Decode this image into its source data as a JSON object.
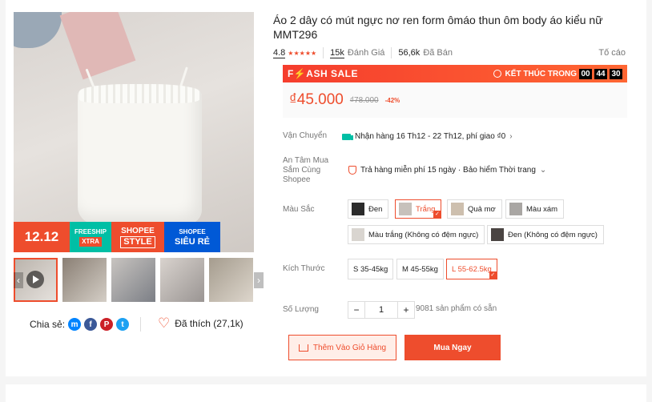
{
  "product": {
    "title": "Áo 2 dây có mút ngực nơ ren form ômáo thun ôm body áo kiểu nữ MMT296"
  },
  "gallery": {
    "promo": {
      "sale": "12.12",
      "freeship": "FREESHIP",
      "xtra": "XTRA",
      "shopee": "SHOPEE",
      "style": "STYLE",
      "shopee2": "SHOPEE",
      "sieure": "SIÊU RẺ"
    },
    "prev_arrow": "‹",
    "next_arrow": "›"
  },
  "share": {
    "label": "Chia sẻ:",
    "icons": [
      "messenger-icon",
      "facebook-icon",
      "pinterest-icon",
      "twitter-icon"
    ],
    "glyphs": [
      "m",
      "f",
      "P",
      "t"
    ],
    "colors": [
      "#0084ff",
      "#3b5998",
      "#cb2027",
      "#1da1f2"
    ]
  },
  "likes": {
    "label": "Đã thích (27,1k)"
  },
  "stats": {
    "rating": "4.8",
    "stars": "★★★★★",
    "reviews_count": "15k",
    "reviews_label": "Đánh Giá",
    "sold_count": "56,6k",
    "sold_label": "Đã Bán",
    "report": "Tố cáo"
  },
  "flash_sale": {
    "title": "F⚡ASH SALE",
    "ends_label": "KẾT THÚC TRONG",
    "hours": "00",
    "minutes": "44",
    "seconds": "30"
  },
  "price": {
    "current": "₫45.000",
    "original": "₫78.000",
    "discount": "-42%"
  },
  "shipping": {
    "label": "Vận Chuyển",
    "value": "Nhận hàng 16 Th12 - 22 Th12, phí giao ₫0",
    "chevron": "›"
  },
  "guarantee": {
    "label": "An Tâm Mua Sắm Cùng Shopee",
    "value": "Trả hàng miễn phí 15 ngày · Bảo hiểm Thời trang",
    "chevron": "⌄"
  },
  "colors": {
    "label": "Màu Sắc",
    "options": [
      "Đen",
      "Trắng",
      "Quả mơ",
      "Màu xám",
      "Màu trắng (Không có đệm ngực)",
      "Đen (Không có đệm ngực)"
    ],
    "selected": "Trắng",
    "swatch_colors": [
      "#2b2b2b",
      "#c7c1bb",
      "#cdbfae",
      "#a9a6a3",
      "#d9d5d0",
      "#4a4442"
    ]
  },
  "sizes": {
    "label": "Kích Thước",
    "options": [
      "S 35-45kg",
      "M 45-55kg",
      "L 55-62.5kg"
    ],
    "selected": "L 55-62.5kg"
  },
  "quantity": {
    "label": "Số Lượng",
    "minus": "−",
    "value": "1",
    "plus": "+",
    "stock": "9081 sản phẩm có sẵn"
  },
  "actions": {
    "add_to_cart": "Thêm Vào Giỏ Hàng",
    "buy_now": "Mua Ngay"
  }
}
